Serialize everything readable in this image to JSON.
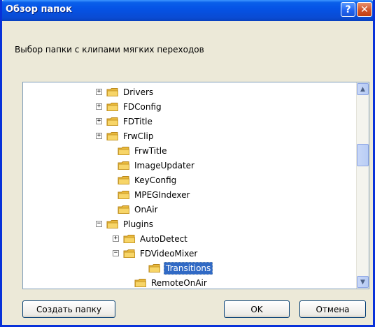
{
  "window": {
    "title": "Обзор папок"
  },
  "description": "Выбор папки с клипами мягких переходов",
  "tree": {
    "items": [
      {
        "label": "Drivers",
        "expander": "+"
      },
      {
        "label": "FDConfig",
        "expander": "+"
      },
      {
        "label": "FDTitle",
        "expander": "+"
      },
      {
        "label": "FrwClip",
        "expander": "+"
      },
      {
        "label": "FrwTitle",
        "expander": ""
      },
      {
        "label": "ImageUpdater",
        "expander": ""
      },
      {
        "label": "KeyConfig",
        "expander": ""
      },
      {
        "label": "MPEGIndexer",
        "expander": ""
      },
      {
        "label": "OnAir",
        "expander": ""
      },
      {
        "label": "Plugins",
        "expander": "−"
      },
      {
        "label": "AutoDetect",
        "expander": "+"
      },
      {
        "label": "FDVideoMixer",
        "expander": "−"
      },
      {
        "label": "Transitions",
        "expander": "",
        "selected": true
      },
      {
        "label": "RemoteOnAir",
        "expander": ""
      }
    ]
  },
  "buttons": {
    "new_folder": "Создать папку",
    "ok": "OK",
    "cancel": "Отмена"
  },
  "icons": {
    "help": "?",
    "close": "✕",
    "scroll_up": "▲",
    "scroll_down": "▼"
  },
  "colors": {
    "titlebar": "#0553E6",
    "selection": "#316AC5",
    "folder": "#F7D568"
  }
}
